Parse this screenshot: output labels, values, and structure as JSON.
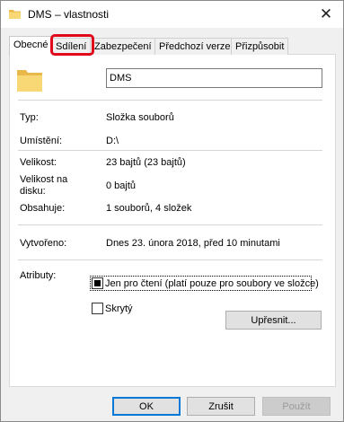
{
  "window": {
    "title": "DMS – vlastnosti",
    "close_symbol": "✕",
    "folder_icon": "folder-icon",
    "folder_color": "#f8d775"
  },
  "tabs": [
    {
      "label": "Obecné",
      "active": true
    },
    {
      "label": "Sdílení",
      "active": false,
      "highlighted": true
    },
    {
      "label": "Zabezpečení",
      "active": false
    },
    {
      "label": "Předchozí verze",
      "active": false
    },
    {
      "label": "Přizpůsobit",
      "active": false
    }
  ],
  "general": {
    "name_value": "DMS",
    "fields": {
      "type_label": "Typ:",
      "type_value": "Složka souborů",
      "location_label": "Umístění:",
      "location_value": "D:\\",
      "size_label": "Velikost:",
      "size_value": "23 bajtů (23 bajtů)",
      "size_on_disk_label": "Velikost na disku:",
      "size_on_disk_value": "0 bajtů",
      "contains_label": "Obsahuje:",
      "contains_value": "1 souborů, 4 složek",
      "created_label": "Vytvořeno:",
      "created_value": "Dnes 23. února 2018, před 10 minutami"
    },
    "attributes": {
      "label": "Atributy:",
      "readonly_label": "Jen pro čtení (platí pouze pro soubory ve složce)",
      "readonly_state": "indeterminate",
      "hidden_label": "Skrytý",
      "hidden_state": "unchecked",
      "advanced_button": "Upřesnit..."
    }
  },
  "buttons": {
    "ok": "OK",
    "cancel": "Zrušit",
    "apply": "Použít"
  },
  "colors": {
    "highlight": "#e0081a",
    "accent": "#0078d7"
  }
}
